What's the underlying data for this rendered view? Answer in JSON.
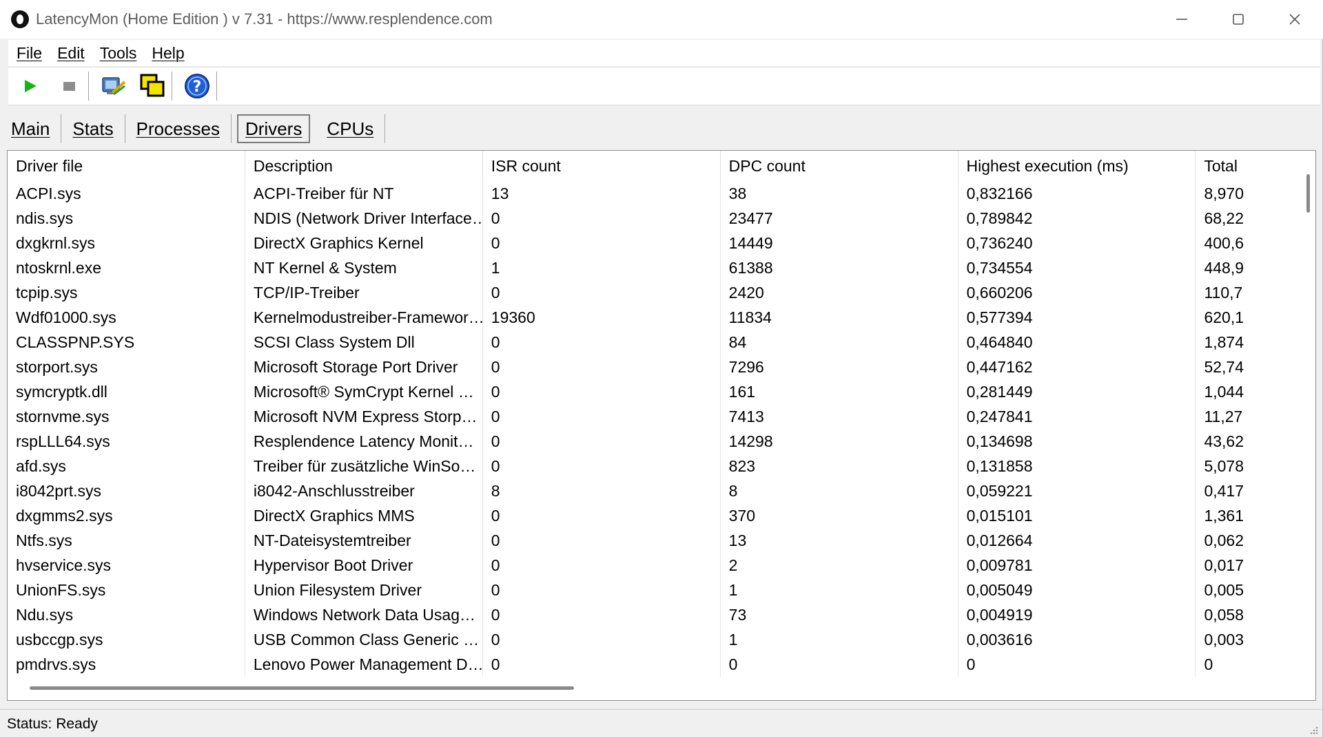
{
  "window": {
    "title": "LatencyMon  (Home Edition )  v 7.31 - https://www.resplendence.com",
    "minimize_icon": "minimize-icon",
    "maximize_icon": "maximize-icon",
    "close_icon": "close-icon"
  },
  "menu": {
    "items": [
      {
        "label": "File"
      },
      {
        "label": "Edit"
      },
      {
        "label": "Tools"
      },
      {
        "label": "Help"
      }
    ]
  },
  "toolbar": {
    "buttons": [
      {
        "icon": "play-icon",
        "color": "#17b217"
      },
      {
        "icon": "stop-icon",
        "color": "#8c8c8c"
      },
      {
        "icon": "analyze-icon"
      },
      {
        "icon": "windows-icon"
      },
      {
        "icon": "help-icon",
        "color": "#1f5fd8"
      }
    ]
  },
  "tabs": [
    {
      "label": "Main",
      "active": false
    },
    {
      "label": "Stats",
      "active": false
    },
    {
      "label": "Processes",
      "active": false
    },
    {
      "label": "Drivers",
      "active": true
    },
    {
      "label": "CPUs",
      "active": false
    }
  ],
  "table": {
    "columns": [
      "Driver file",
      "Description",
      "ISR count",
      "DPC count",
      "Highest execution (ms)",
      "Total"
    ],
    "rows": [
      [
        "ACPI.sys",
        "ACPI-Treiber für NT",
        "13",
        "38",
        "0,832166",
        "8,970"
      ],
      [
        "ndis.sys",
        "NDIS (Network Driver Interface…",
        "0",
        "23477",
        "0,789842",
        "68,22"
      ],
      [
        "dxgkrnl.sys",
        "DirectX Graphics Kernel",
        "0",
        "14449",
        "0,736240",
        "400,6"
      ],
      [
        "ntoskrnl.exe",
        "NT Kernel & System",
        "1",
        "61388",
        "0,734554",
        "448,9"
      ],
      [
        "tcpip.sys",
        "TCP/IP-Treiber",
        "0",
        "2420",
        "0,660206",
        "110,7"
      ],
      [
        "Wdf01000.sys",
        "Kernelmodustreiber-Framewor…",
        "19360",
        "11834",
        "0,577394",
        "620,1"
      ],
      [
        "CLASSPNP.SYS",
        "SCSI Class System Dll",
        "0",
        "84",
        "0,464840",
        "1,874"
      ],
      [
        "storport.sys",
        "Microsoft Storage Port Driver",
        "0",
        "7296",
        "0,447162",
        "52,74"
      ],
      [
        "symcryptk.dll",
        "Microsoft® SymCrypt Kernel …",
        "0",
        "161",
        "0,281449",
        "1,044"
      ],
      [
        "stornvme.sys",
        "Microsoft NVM Express Storp…",
        "0",
        "7413",
        "0,247841",
        "11,27"
      ],
      [
        "rspLLL64.sys",
        "Resplendence Latency Monit…",
        "0",
        "14298",
        "0,134698",
        "43,62"
      ],
      [
        "afd.sys",
        "Treiber für zusätzliche WinSo…",
        "0",
        "823",
        "0,131858",
        "5,078"
      ],
      [
        "i8042prt.sys",
        "i8042-Anschlusstreiber",
        "8",
        "8",
        "0,059221",
        "0,417"
      ],
      [
        "dxgmms2.sys",
        "DirectX Graphics MMS",
        "0",
        "370",
        "0,015101",
        "1,361"
      ],
      [
        "Ntfs.sys",
        "NT-Dateisystemtreiber",
        "0",
        "13",
        "0,012664",
        "0,062"
      ],
      [
        "hvservice.sys",
        "Hypervisor Boot Driver",
        "0",
        "2",
        "0,009781",
        "0,017"
      ],
      [
        "UnionFS.sys",
        "Union Filesystem Driver",
        "0",
        "1",
        "0,005049",
        "0,005"
      ],
      [
        "Ndu.sys",
        "Windows Network Data Usag…",
        "0",
        "73",
        "0,004919",
        "0,058"
      ],
      [
        "usbccgp.sys",
        "USB Common Class Generic …",
        "0",
        "1",
        "0,003616",
        "0,003"
      ],
      [
        "pmdrvs.sys",
        "Lenovo Power Management D…",
        "0",
        "0",
        "0",
        "0"
      ]
    ]
  },
  "status": {
    "text": "Status: Ready"
  }
}
